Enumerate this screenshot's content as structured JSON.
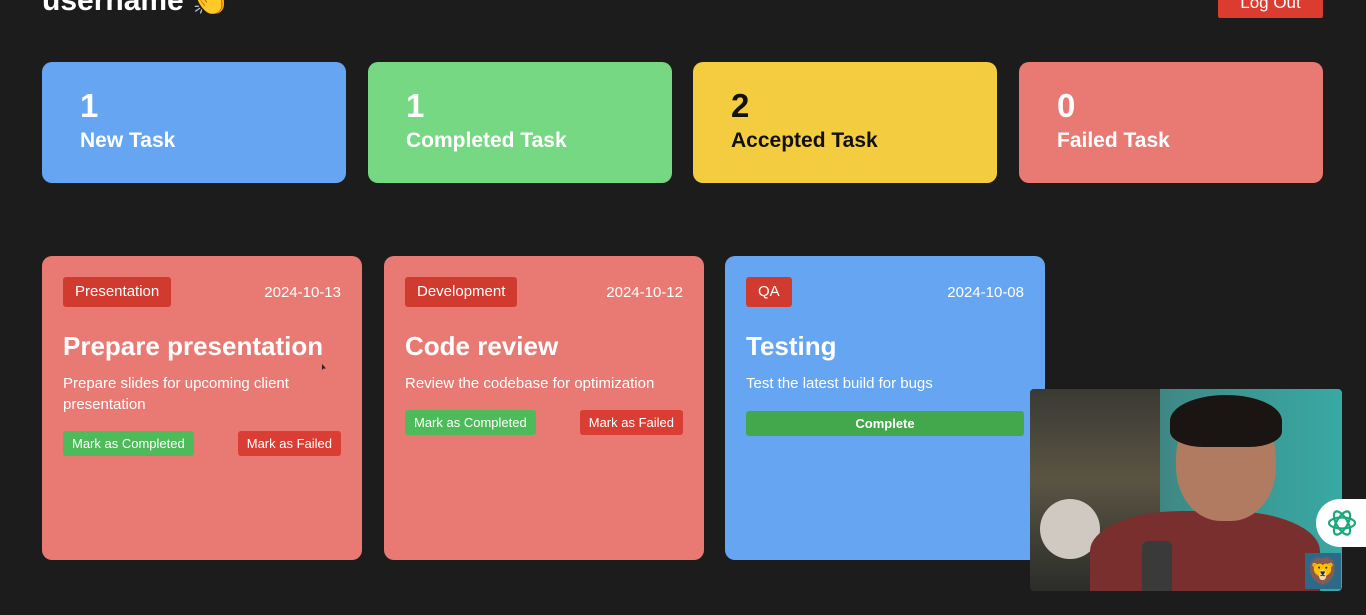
{
  "header": {
    "greeting": "username 👏",
    "logout_label": "Log Out"
  },
  "stats": [
    {
      "count": "1",
      "label": "New Task"
    },
    {
      "count": "1",
      "label": "Completed Task"
    },
    {
      "count": "2",
      "label": "Accepted Task"
    },
    {
      "count": "0",
      "label": "Failed Task"
    }
  ],
  "tasks": [
    {
      "category": "Presentation",
      "date": "2024-10-13",
      "title": "Prepare presentation",
      "description": "Prepare slides for upcoming client presentation",
      "complete_label": "Mark as Completed",
      "fail_label": "Mark as Failed"
    },
    {
      "category": "Development",
      "date": "2024-10-12",
      "title": "Code review",
      "description": "Review the codebase for optimization",
      "complete_label": "Mark as Completed",
      "fail_label": "Mark as Failed"
    },
    {
      "category": "QA",
      "date": "2024-10-08",
      "title": "Testing",
      "description": "Test the latest build for bugs",
      "status_label": "Complete"
    }
  ],
  "overlay": {
    "badge_emoji": "🦁",
    "assistant_icon": "openai-icon"
  },
  "colors": {
    "background": "#1c1c1c",
    "new": "#66a5f2",
    "completed": "#77d884",
    "accepted": "#f4cc3f",
    "failed": "#e87a73",
    "danger": "#d93d33",
    "success": "#4dbb5a"
  }
}
